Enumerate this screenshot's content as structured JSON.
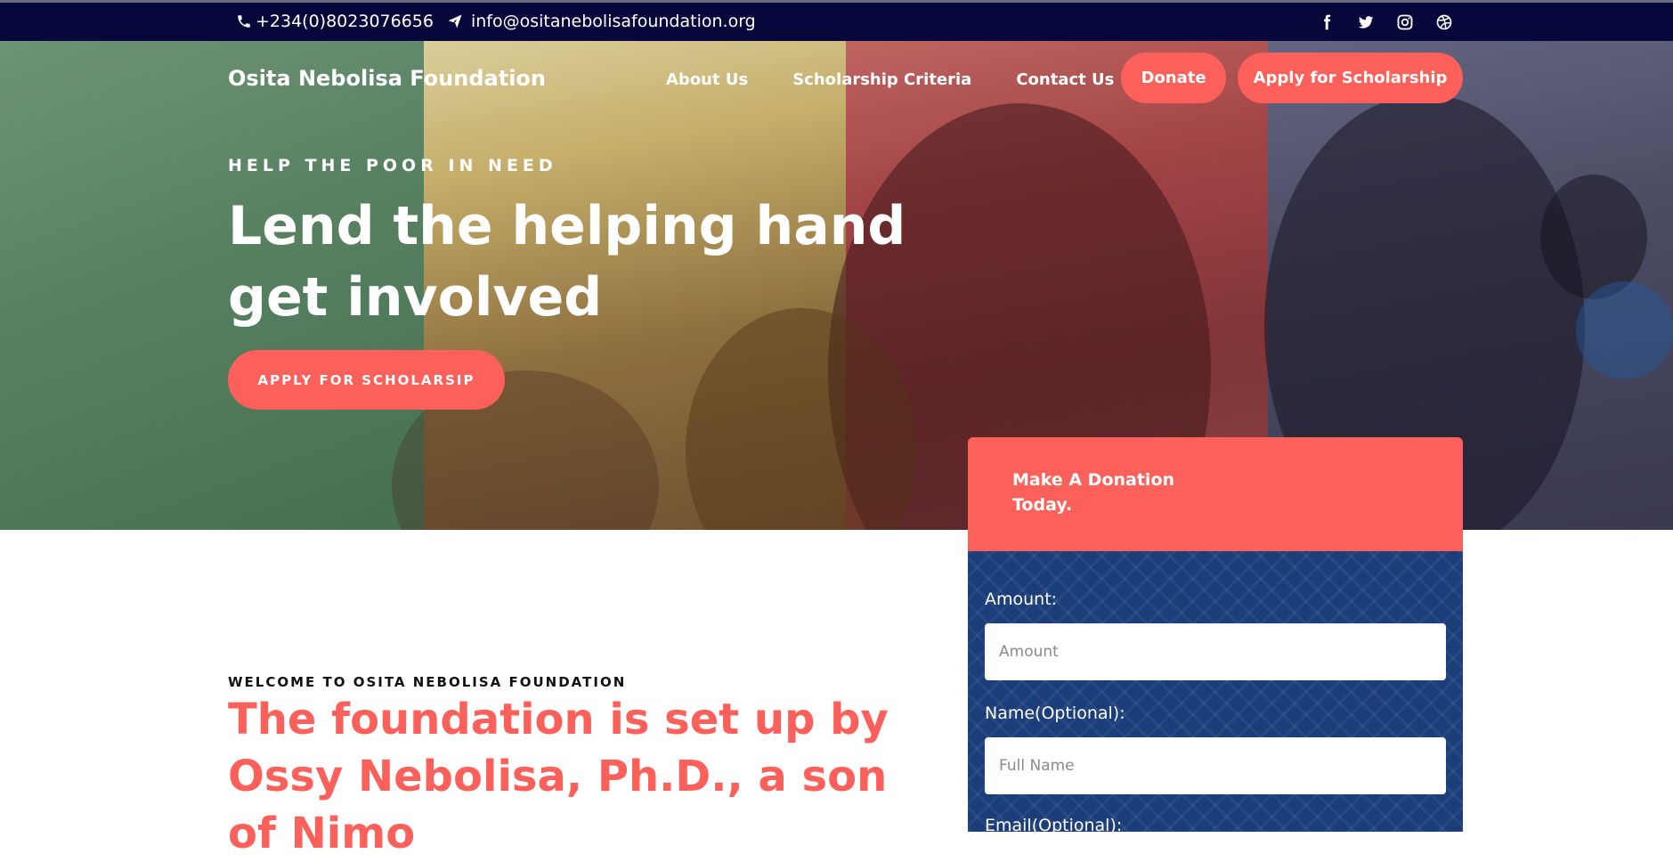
{
  "topbar": {
    "phone": "+234(0)8023076656",
    "email": "info@ositanebolisafoundation.org",
    "icons": [
      "phone-icon",
      "paper-plane-icon",
      "facebook-icon",
      "twitter-icon",
      "instagram-icon",
      "dribbble-icon"
    ]
  },
  "nav": {
    "brand": "Osita Nebolisa Foundation",
    "links": [
      "About Us",
      "Scholarship Criteria",
      "Contact Us"
    ],
    "donate": "Donate",
    "apply": "Apply for Scholarship"
  },
  "hero": {
    "tagline": "HELP THE POOR IN NEED",
    "headline": "Lend the helping hand get involved",
    "cta": "APPLY FOR SCHOLARSIP"
  },
  "donation": {
    "title": "Make A Donation Today.",
    "amount_label": "Amount:",
    "amount_placeholder": "Amount",
    "name_label": "Name(Optional):",
    "name_placeholder": "Full Name",
    "email_label": "Email(Optional):"
  },
  "welcome": {
    "label": "WELCOME TO OSITA NEBOLISA FOUNDATION",
    "title": "The foundation is set up by Ossy Nebolisa, Ph.D., a son of Nimo"
  },
  "colors": {
    "accent": "#fc605a",
    "topbar": "#06073a",
    "card_body": "#1b3d7a"
  }
}
